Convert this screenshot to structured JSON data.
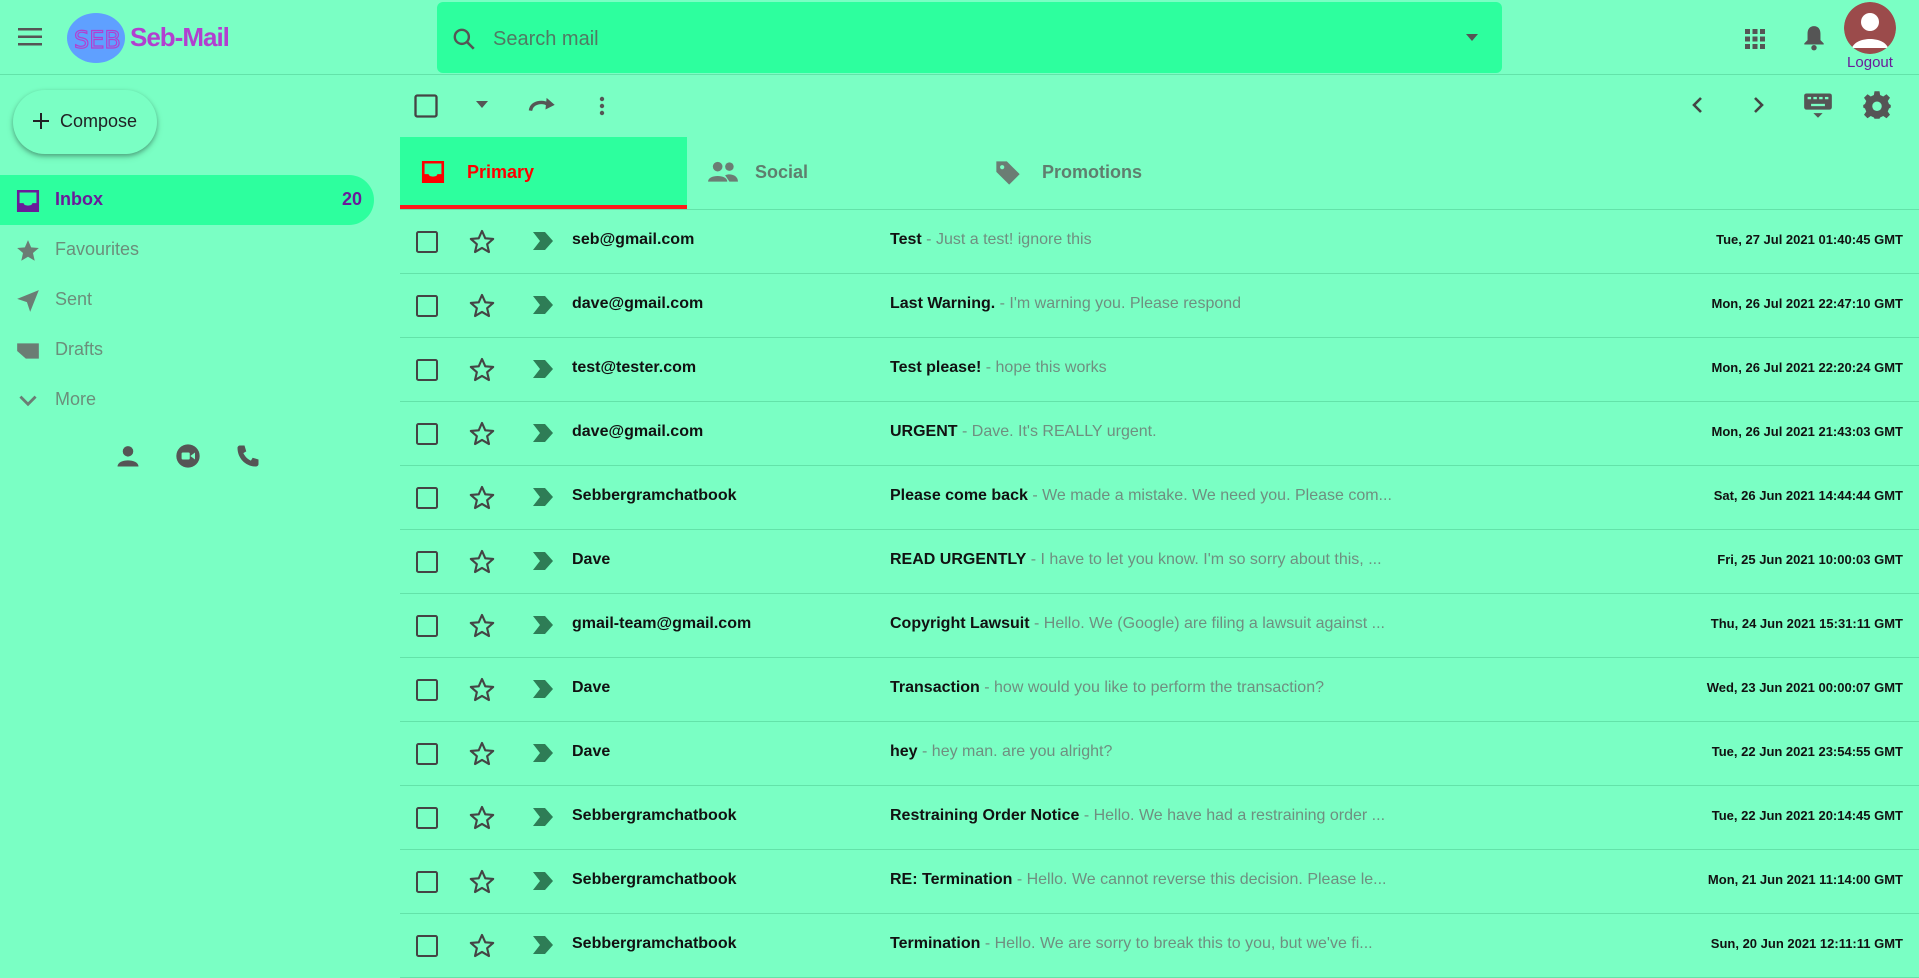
{
  "app": {
    "brand": "Seb-Mail",
    "logo_text": "SEB"
  },
  "search": {
    "placeholder": "Search mail",
    "value": ""
  },
  "header": {
    "logout_label": "Logout"
  },
  "compose": {
    "label": "Compose"
  },
  "sidebar": {
    "items": [
      {
        "label": "Inbox",
        "count": "20",
        "icon": "inbox-icon"
      },
      {
        "label": "Favourites",
        "icon": "star-icon"
      },
      {
        "label": "Sent",
        "icon": "send-icon"
      },
      {
        "label": "Drafts",
        "icon": "label-icon"
      },
      {
        "label": "More",
        "icon": "chevron-down-icon"
      }
    ]
  },
  "tabs": [
    {
      "label": "Primary",
      "icon": "inbox-icon"
    },
    {
      "label": "Social",
      "icon": "people-icon"
    },
    {
      "label": "Promotions",
      "icon": "tag-icon"
    }
  ],
  "emails": [
    {
      "sender": "seb@gmail.com",
      "subject": "Test",
      "preview": "Just a test! ignore this",
      "date": "Tue, 27 Jul 2021 01:40:45 GMT"
    },
    {
      "sender": "dave@gmail.com",
      "subject": "Last Warning.",
      "preview": "I'm warning you. Please respond",
      "date": "Mon, 26 Jul 2021 22:47:10 GMT"
    },
    {
      "sender": "test@tester.com",
      "subject": "Test please!",
      "preview": "hope this works",
      "date": "Mon, 26 Jul 2021 22:20:24 GMT"
    },
    {
      "sender": "dave@gmail.com",
      "subject": "URGENT",
      "preview": "Dave. It's REALLY urgent.",
      "date": "Mon, 26 Jul 2021 21:43:03 GMT"
    },
    {
      "sender": "Sebbergramchatbook",
      "subject": "Please come back",
      "preview": "We made a mistake. We need you. Please com...",
      "date": "Sat, 26 Jun 2021 14:44:44 GMT"
    },
    {
      "sender": "Dave",
      "subject": "READ URGENTLY",
      "preview": "I have to let you know. I'm so sorry about this, ...",
      "date": "Fri, 25 Jun 2021 10:00:03 GMT"
    },
    {
      "sender": "gmail-team@gmail.com",
      "subject": "Copyright Lawsuit",
      "preview": "Hello. We (Google) are filing a lawsuit against ...",
      "date": "Thu, 24 Jun 2021 15:31:11 GMT"
    },
    {
      "sender": "Dave",
      "subject": "Transaction",
      "preview": "how would you like to perform the transaction?",
      "date": "Wed, 23 Jun 2021 00:00:07 GMT"
    },
    {
      "sender": "Dave",
      "subject": "hey",
      "preview": "hey man. are you alright?",
      "date": "Tue, 22 Jun 2021 23:54:55 GMT"
    },
    {
      "sender": "Sebbergramchatbook",
      "subject": "Restraining Order Notice",
      "preview": "Hello. We have had a restraining order ...",
      "date": "Tue, 22 Jun 2021 20:14:45 GMT"
    },
    {
      "sender": "Sebbergramchatbook",
      "subject": "RE: Termination",
      "preview": "Hello. We cannot reverse this decision. Please le...",
      "date": "Mon, 21 Jun 2021 11:14:00 GMT"
    },
    {
      "sender": "Sebbergramchatbook",
      "subject": "Termination",
      "preview": "Hello. We are sorry to break this to you, but we've fi...",
      "date": "Sun, 20 Jun 2021 12:11:11 GMT"
    }
  ],
  "colors": {
    "background": "#7affc4",
    "accent": "#2dff9e",
    "active_tab": "#ff0000",
    "brand": "#b23fd0",
    "inbox_label": "#6a1b9a"
  }
}
